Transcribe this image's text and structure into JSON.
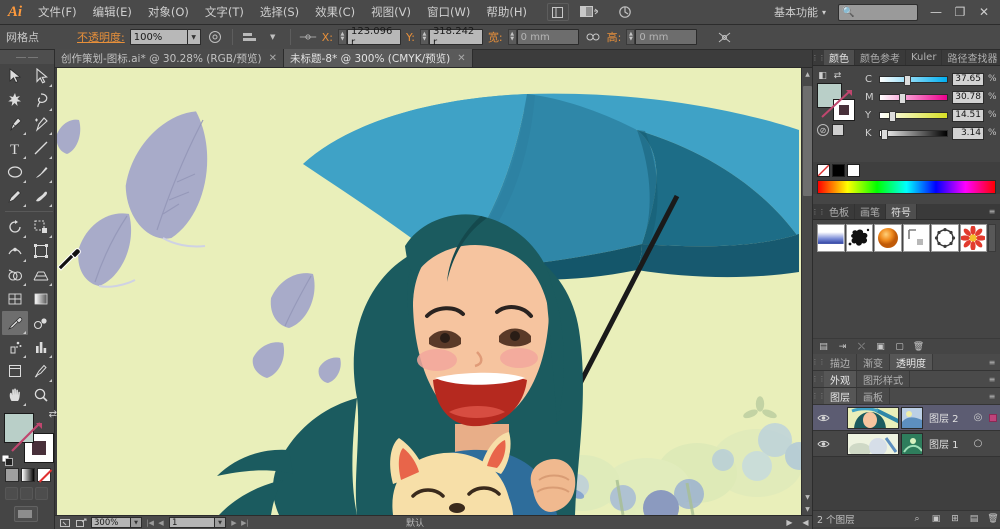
{
  "menubar": {
    "logo": "Ai",
    "items": [
      {
        "label": "文件(F)",
        "name": "menu-file"
      },
      {
        "label": "编辑(E)",
        "name": "menu-edit"
      },
      {
        "label": "对象(O)",
        "name": "menu-object"
      },
      {
        "label": "文字(T)",
        "name": "menu-type"
      },
      {
        "label": "选择(S)",
        "name": "menu-select"
      },
      {
        "label": "效果(C)",
        "name": "menu-effect"
      },
      {
        "label": "视图(V)",
        "name": "menu-view"
      },
      {
        "label": "窗口(W)",
        "name": "menu-window"
      },
      {
        "label": "帮助(H)",
        "name": "menu-help"
      }
    ],
    "bridge_icon": "br-icon",
    "arrange_icon": "arrange-documents-icon",
    "stock_icon": "stock-icon",
    "workspace": "基本功能",
    "workspace_caret": "▾",
    "search_placeholder": "",
    "search_value": "",
    "minimize": "—",
    "restore": "❐",
    "close": "✕"
  },
  "controlbar": {
    "selection_type": "网格点",
    "opacity_label": "不透明度:",
    "opacity_value": "100%",
    "x_label": "X:",
    "x_value": "123.096 r",
    "y_label": "Y:",
    "y_value": "318.242 r",
    "w_label": "宽:",
    "w_value": "0 mm",
    "h_label": "高:",
    "h_value": "0 mm",
    "link_icon": "link-icon",
    "transform_icon": "transform-icon",
    "align_icon": "align-icon",
    "style_icon": "graphic-style-icon"
  },
  "tabs": [
    {
      "title": "创作策划-图标.ai* @ 30.28% (RGB/预览)",
      "active": false,
      "close": "✕"
    },
    {
      "title": "未标题-8* @ 300% (CMYK/预览)",
      "active": true,
      "close": "✕"
    }
  ],
  "statusbar": {
    "zoom_value": "300%",
    "artboard_value": "1",
    "nav_first": "|◀",
    "nav_prev": "◀",
    "nav_next": "▶",
    "nav_last": "▶|",
    "status_text": "默认",
    "cursor_icon": "cursor-icon",
    "share_icon": "share-icon",
    "right_next": "▶",
    "right_prev": "◀"
  },
  "toolbar": {
    "tools": [
      {
        "name": "selection-tool",
        "label": "选择工具",
        "selected": false
      },
      {
        "name": "direct-selection-tool",
        "label": "直接选择工具",
        "selected": false
      },
      {
        "name": "magic-wand-tool",
        "label": "魔棒工具",
        "selected": false
      },
      {
        "name": "lasso-tool",
        "label": "套索工具",
        "selected": false
      },
      {
        "name": "pen-tool",
        "label": "钢笔工具",
        "selected": false
      },
      {
        "name": "add-anchor-point-tool",
        "label": "添加锚点工具",
        "selected": false
      },
      {
        "name": "type-tool",
        "label": "文字工具",
        "selected": false
      },
      {
        "name": "line-segment-tool",
        "label": "直线段工具",
        "selected": false
      },
      {
        "name": "ellipse-tool",
        "label": "椭圆工具",
        "selected": false
      },
      {
        "name": "paintbrush-tool",
        "label": "画笔工具",
        "selected": false
      },
      {
        "name": "pencil-tool",
        "label": "铅笔工具",
        "selected": false
      },
      {
        "name": "blob-brush-tool",
        "label": "斑点画笔工具",
        "selected": false
      },
      {
        "name": "rotate-tool",
        "label": "旋转工具",
        "selected": false
      },
      {
        "name": "scale-tool",
        "label": "比例缩放工具",
        "selected": false
      },
      {
        "name": "width-tool",
        "label": "宽度工具",
        "selected": false
      },
      {
        "name": "free-transform-tool",
        "label": "自由变换工具",
        "selected": false
      },
      {
        "name": "shape-builder-tool",
        "label": "形状生成器工具",
        "selected": false
      },
      {
        "name": "perspective-grid-tool",
        "label": "透视网格工具",
        "selected": false
      },
      {
        "name": "mesh-tool",
        "label": "网格工具",
        "selected": false
      },
      {
        "name": "gradient-tool",
        "label": "渐变工具",
        "selected": false
      },
      {
        "name": "eyedropper-tool",
        "label": "吸管工具",
        "selected": true
      },
      {
        "name": "blend-tool",
        "label": "混合工具",
        "selected": false
      },
      {
        "name": "symbol-sprayer-tool",
        "label": "符号喷枪工具",
        "selected": false
      },
      {
        "name": "column-graph-tool",
        "label": "柱形图工具",
        "selected": false
      },
      {
        "name": "artboard-tool",
        "label": "画板工具",
        "selected": false
      },
      {
        "name": "slice-tool",
        "label": "切片工具",
        "selected": false
      },
      {
        "name": "hand-tool",
        "label": "抓手工具",
        "selected": false
      },
      {
        "name": "zoom-tool",
        "label": "缩放工具",
        "selected": false
      }
    ],
    "fill_color": "#b9cfc8",
    "stroke_color": "#48303a",
    "swap_icon": "swap-fill-stroke-icon",
    "default_icon": "default-fill-stroke-icon",
    "mode_color": "颜色",
    "mode_gradient": "渐变",
    "mode_none": "无",
    "draw_normal": "正常绘图",
    "draw_behind": "背面绘图",
    "draw_inside": "内部绘图",
    "screen_mode": "更改屏幕模式"
  },
  "color_panel": {
    "tabs": [
      {
        "label": "颜色",
        "active": true
      },
      {
        "label": "颜色参考",
        "active": false
      },
      {
        "label": "Kuler",
        "active": false
      },
      {
        "label": "路径查找器",
        "active": false
      }
    ],
    "menu_icon": "panel-menu-icon",
    "mode": "CMYK",
    "channels": [
      {
        "key": "C",
        "value": "37.65",
        "pct": "%",
        "pos": 38
      },
      {
        "key": "M",
        "value": "30.78",
        "pct": "%",
        "pos": 31
      },
      {
        "key": "Y",
        "value": "14.51",
        "pct": "%",
        "pos": 15
      },
      {
        "key": "K",
        "value": "3.14",
        "pct": "%",
        "pos": 3
      }
    ],
    "fill_color": "#b9cfc8",
    "stroke_color": "#48303a",
    "swatch_none": "无",
    "swatch_black": "#000000",
    "swatch_white": "#ffffff"
  },
  "symbols_panel": {
    "tabs": [
      {
        "label": "色板",
        "active": false
      },
      {
        "label": "画笔",
        "active": false
      },
      {
        "label": "符号",
        "active": true
      }
    ],
    "menu_icon": "panel-menu-icon",
    "items": [
      {
        "name": "symbol-gradient-bar",
        "label": "渐变条"
      },
      {
        "name": "symbol-ink-splat",
        "label": "墨点"
      },
      {
        "name": "symbol-orange-sphere",
        "label": "橙色球体"
      },
      {
        "name": "symbol-corner-mark",
        "label": "角标"
      },
      {
        "name": "symbol-ring-dots",
        "label": "环形点"
      },
      {
        "name": "symbol-red-flower",
        "label": "红花"
      }
    ],
    "footer_icons": [
      {
        "name": "symbol-libraries-icon",
        "glyph": "▤"
      },
      {
        "name": "place-symbol-instance-icon",
        "glyph": "⇥"
      },
      {
        "name": "break-link-icon",
        "glyph": "⤬"
      },
      {
        "name": "symbol-options-icon",
        "glyph": "▣"
      },
      {
        "name": "new-symbol-icon",
        "glyph": "▢"
      },
      {
        "name": "delete-symbol-icon",
        "glyph": "🗑"
      }
    ]
  },
  "collapsed_panels": [
    {
      "tabs": [
        {
          "label": "描边",
          "active": false
        },
        {
          "label": "渐变",
          "active": false
        },
        {
          "label": "透明度",
          "active": true
        }
      ],
      "name": "stroke-gradient-transparency-group"
    },
    {
      "tabs": [
        {
          "label": "外观",
          "active": true
        },
        {
          "label": "图形样式",
          "active": false
        }
      ],
      "name": "appearance-graphicstyles-group"
    }
  ],
  "layers_panel": {
    "tabs": [
      {
        "label": "图层",
        "active": true
      },
      {
        "label": "画板",
        "active": false
      }
    ],
    "menu_icon": "panel-menu-icon",
    "rows": [
      {
        "name": "图层 2",
        "selected": true,
        "visible": true,
        "locked": false,
        "target": "◎",
        "has_selection": true
      },
      {
        "name": "图层 1",
        "selected": false,
        "visible": true,
        "locked": false,
        "target": "○",
        "has_selection": false
      }
    ],
    "count_text": "2 个图层",
    "footer_icons": [
      {
        "name": "locate-object-icon",
        "glyph": "⌕"
      },
      {
        "name": "make-clipping-mask-icon",
        "glyph": "▣"
      },
      {
        "name": "create-new-sublayer-icon",
        "glyph": "⊞"
      },
      {
        "name": "create-new-layer-icon",
        "glyph": "▤"
      },
      {
        "name": "delete-layer-icon",
        "glyph": "🗑"
      }
    ]
  },
  "artwork": {
    "background_color": "#e9efba",
    "umbrella_colors": [
      "#3e9fc4",
      "#2e7f9e",
      "#1d6b84",
      "#155c72",
      "#0f4d61"
    ],
    "hair_color": "#1b5b5f",
    "skin_color": "#f6c49f",
    "cheek_color": "#f2a79c",
    "mouth_color": "#b5291f",
    "shirt_color": "#2e6d9b",
    "leaf_color": "#a8abc9",
    "cat_color": "#f7dfa8",
    "cat_ear_color": "#e8654a",
    "flower_blue": "#8fa8d6",
    "flower_teal": "#9dc4c0"
  }
}
